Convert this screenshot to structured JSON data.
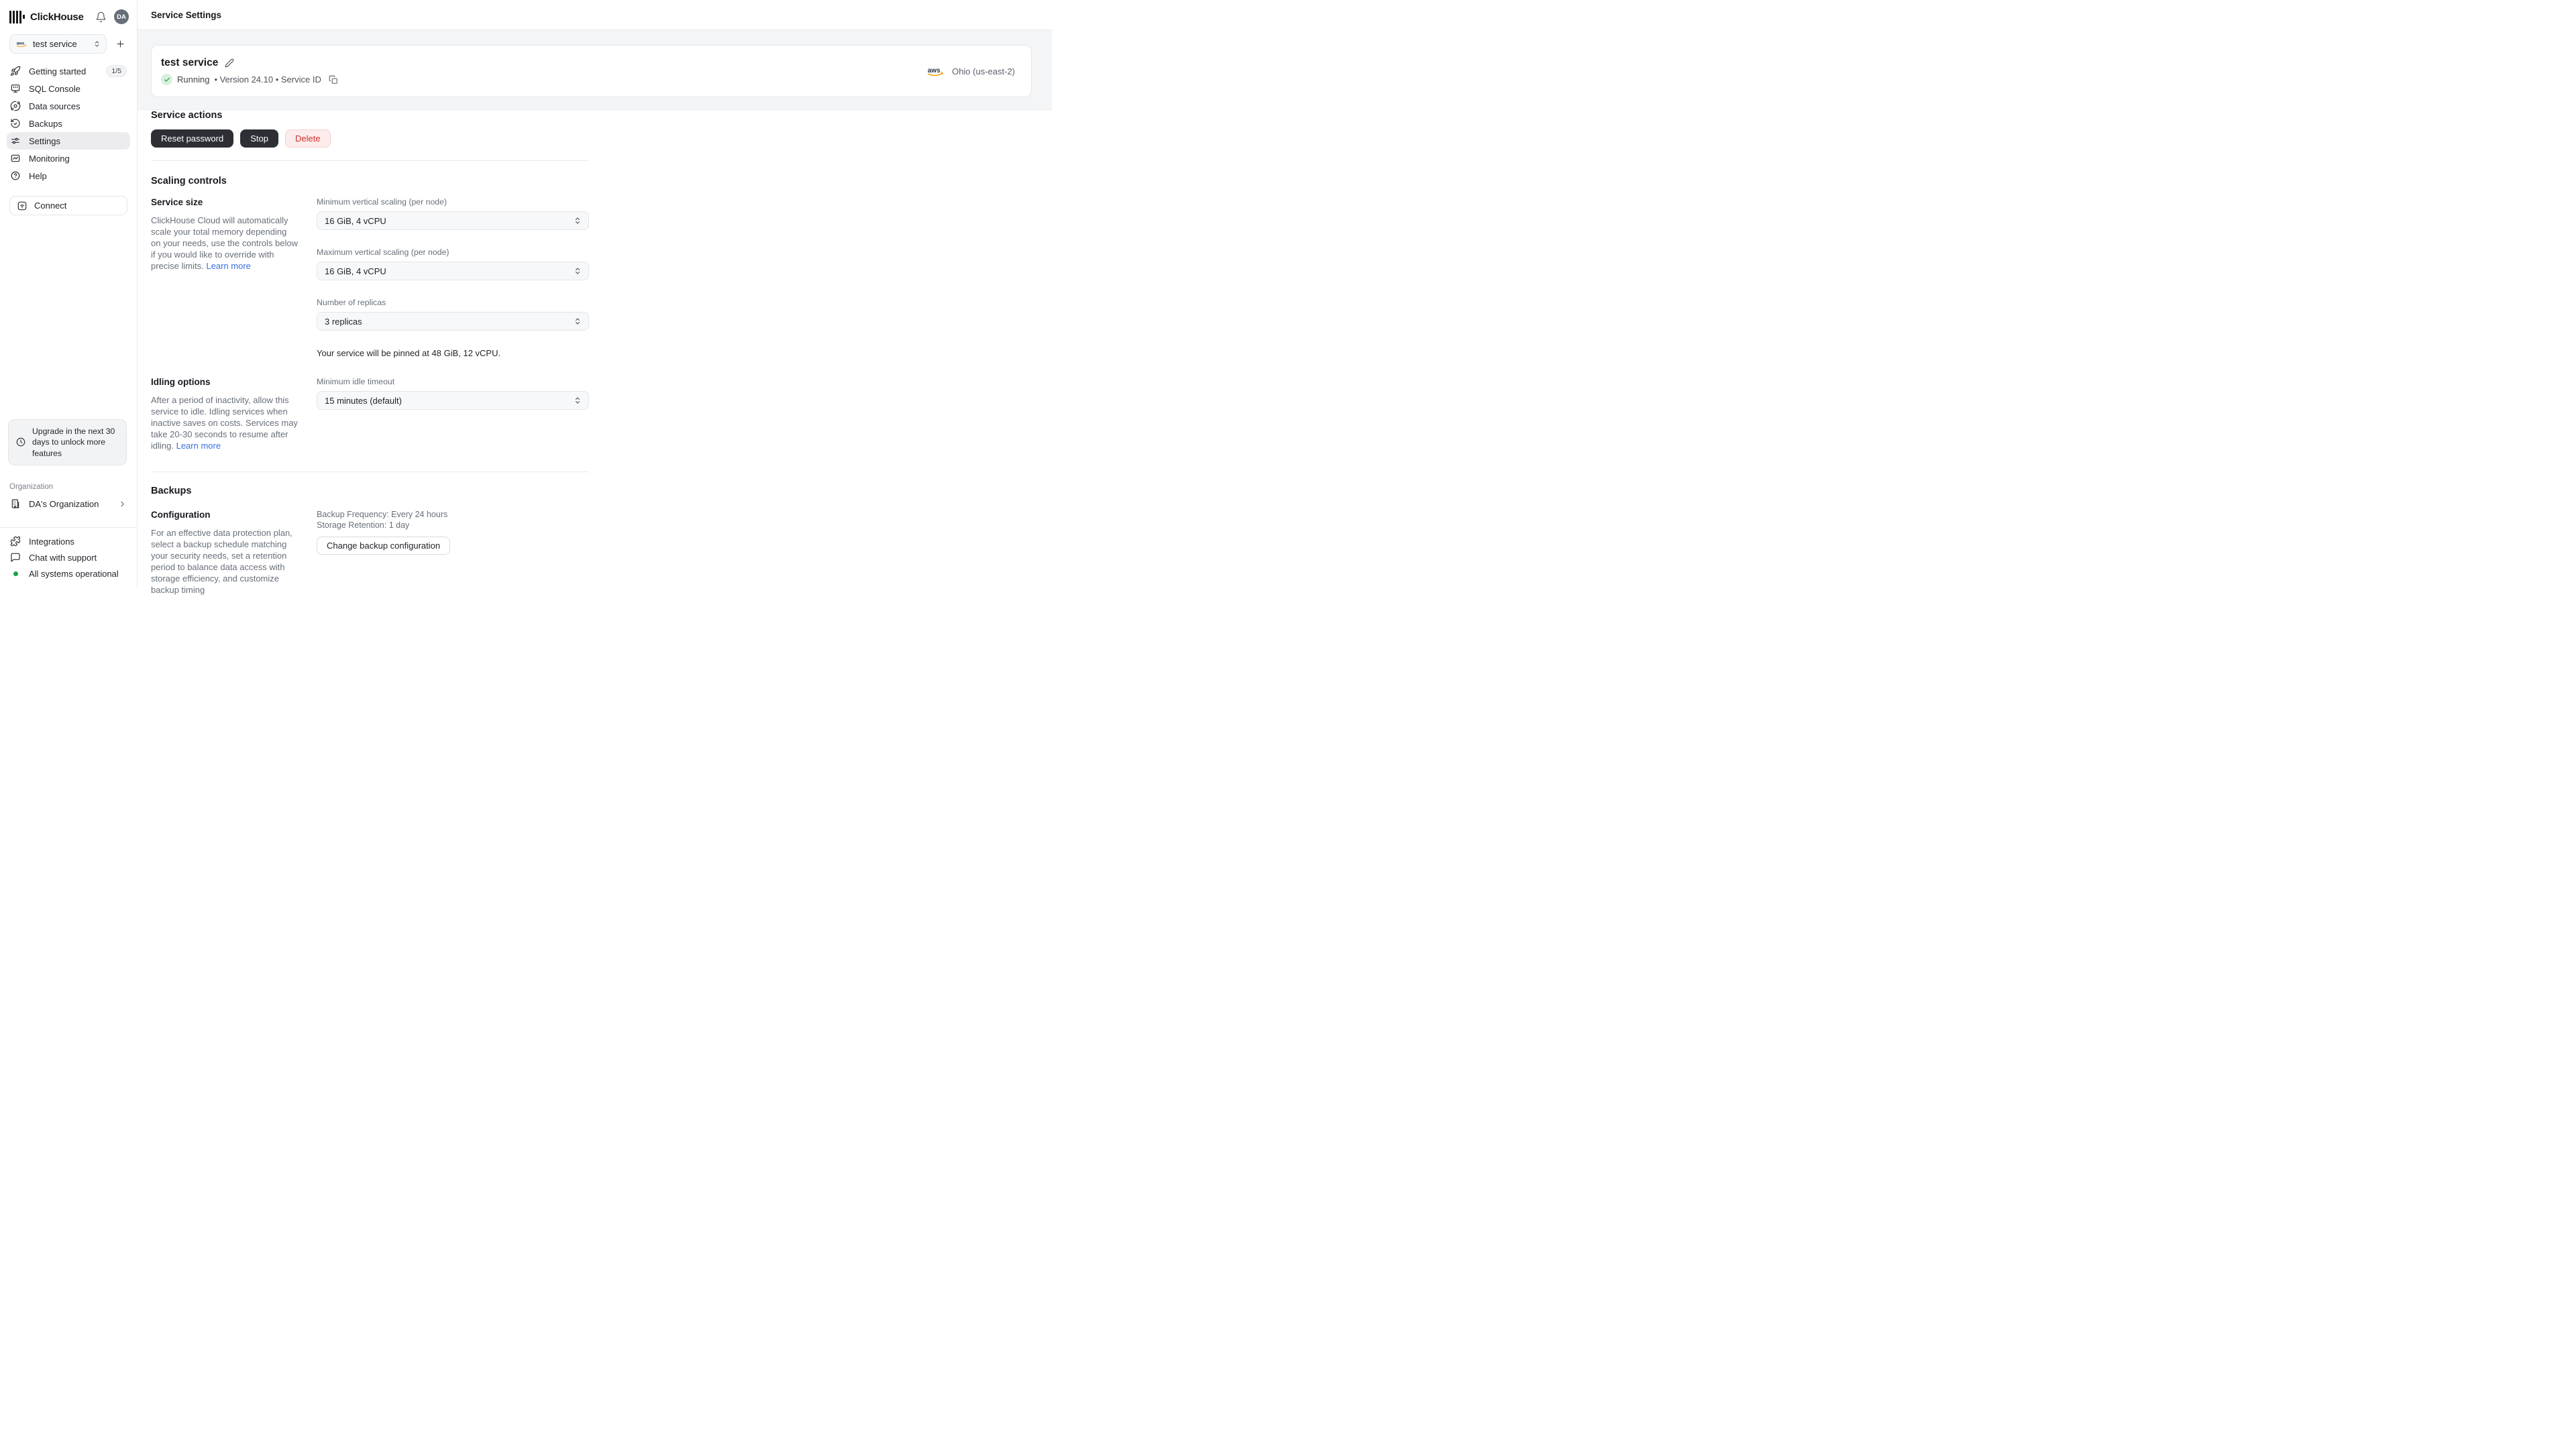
{
  "colors": {
    "accent_link": "#3b6fe3",
    "status_green": "#17a34a",
    "danger_red": "#d2302e",
    "aws_orange": "#ff9900",
    "dark_button": "#2d2f34"
  },
  "brand": {
    "name": "ClickHouse",
    "avatar_initials": "DA"
  },
  "sidebar": {
    "service_selector": {
      "value": "test service"
    },
    "items": [
      {
        "label": "Getting started",
        "badge": "1/5"
      },
      {
        "label": "SQL Console"
      },
      {
        "label": "Data sources"
      },
      {
        "label": "Backups"
      },
      {
        "label": "Settings"
      },
      {
        "label": "Monitoring"
      },
      {
        "label": "Help"
      }
    ],
    "connect_label": "Connect",
    "upgrade_notice": "Upgrade in the next 30 days to unlock more features",
    "organization_label": "Organization",
    "organization_name": "DA's Organization",
    "integrations_label": "Integrations",
    "chat_label": "Chat with support",
    "status_text": "All systems operational"
  },
  "header": {
    "title": "Service Settings"
  },
  "service_card": {
    "name": "test service",
    "status": "Running",
    "meta": "• Version 24.10 • Service ID",
    "region": "Ohio (us-east-2)"
  },
  "service_actions": {
    "title": "Service actions",
    "reset_label": "Reset password",
    "stop_label": "Stop",
    "delete_label": "Delete"
  },
  "scaling": {
    "title": "Scaling controls",
    "service_size_title": "Service size",
    "description": "ClickHouse Cloud will automatically scale your total memory depending on your needs, use the controls below if you would like to override with precise limits.",
    "learn_more": "Learn more",
    "fields": [
      {
        "label": "Minimum vertical scaling (per node)",
        "value": "16 GiB, 4 vCPU"
      },
      {
        "label": "Maximum vertical scaling (per node)",
        "value": "16 GiB, 4 vCPU"
      },
      {
        "label": "Number of replicas",
        "value": "3 replicas"
      }
    ],
    "pinned_note": "Your service will be pinned at 48 GiB, 12 vCPU."
  },
  "idling": {
    "title": "Idling options",
    "description": "After a period of inactivity, allow this service to idle. Idling services when inactive saves on costs. Services may take 20-30 seconds to resume after idling.",
    "learn_more": "Learn more",
    "timeout_label": "Minimum idle timeout",
    "timeout_value": "15 minutes (default)"
  },
  "backups": {
    "title": "Backups",
    "config_title": "Configuration",
    "description": "For an effective data protection plan, select a backup schedule matching your security needs, set a retention period to balance data access with storage efficiency, and customize backup timing",
    "frequency": "Backup Frequency: Every 24 hours",
    "retention": "Storage Retention: 1 day",
    "change_button_label": "Change backup configuration"
  }
}
